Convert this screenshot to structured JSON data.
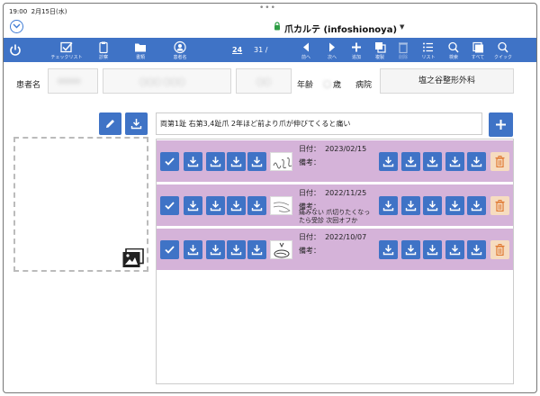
{
  "status": {
    "time": "19:00",
    "date": "2月15日(水)",
    "dots": "•••"
  },
  "app": {
    "title": "爪カルテ (infoshionoya)"
  },
  "toolbar": {
    "checklist": "チェックリスト",
    "diagnosis": "診察",
    "documents": "書類",
    "patient": "患者名",
    "page_current": "24",
    "page_total": "31 /",
    "prev": "前へ",
    "next": "次へ",
    "add": "追加",
    "copy": "複製",
    "delete": "削除",
    "list": "リスト",
    "search": "検索",
    "all": "すべて",
    "quick": "クイック"
  },
  "patient": {
    "name_label": "患者名",
    "name_blur": "00000",
    "kana_blur": "〇〇〇 〇〇〇",
    "age_blur": "〇〇",
    "age_label": "年齢",
    "age_unit": "歳",
    "hospital_label": "病院",
    "hospital": "塩之谷整形外科"
  },
  "memo": "両第1趾 右第3,4趾爪 2年ほど前より爪が伸びてくると痛い",
  "records": [
    {
      "date_label": "日付：",
      "date": "2023/02/15",
      "note_label": "備考：",
      "note": ""
    },
    {
      "date_label": "日付：",
      "date": "2022/11/25",
      "note_label": "備考：",
      "note": "痛みない 爪切りたくなったら受診 次回オフか"
    },
    {
      "date_label": "日付：",
      "date": "2022/10/07",
      "note_label": "備考：",
      "note": ""
    }
  ],
  "colors": {
    "accent": "#3f73c6",
    "record_bg": "#d5b3d9",
    "trash_bg": "#f6dcc0"
  }
}
